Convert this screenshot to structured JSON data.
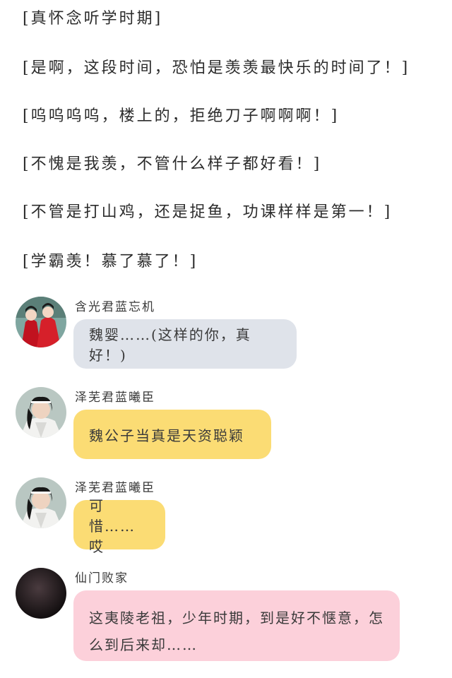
{
  "comments": [
    "[真怀念听学时期]",
    "[是啊，这段时间，恐怕是羡羡最快乐的时间了！]",
    "[呜呜呜呜，楼上的，拒绝刀子啊啊啊！]",
    "[不愧是我羡，不管什么样子都好看！]",
    "[不管是打山鸡，还是捉鱼，功课样样是第一！]",
    "[学霸羡！慕了慕了！]"
  ],
  "chat": [
    {
      "sender": "含光君蓝忘机",
      "text": "魏婴……(这样的你，真好！)",
      "bubble_color": "#dfe3ea",
      "avatar_icon": "red-robed-couple-avatar-icon"
    },
    {
      "sender": "泽芜君蓝曦臣",
      "text": "魏公子当真是天资聪颖",
      "bubble_color": "#fbdc74",
      "avatar_icon": "white-robed-man-avatar-icon"
    },
    {
      "sender": "泽芜君蓝曦臣",
      "text": "可惜……哎",
      "bubble_color": "#fbdc74",
      "avatar_icon": "white-robed-man-avatar-icon"
    },
    {
      "sender": "仙门败家",
      "text": "这夷陵老祖，少年时期，到是好不惬意，怎么到后来却……",
      "bubble_color": "#fcd0da",
      "avatar_icon": "dark-avatar-icon"
    }
  ]
}
